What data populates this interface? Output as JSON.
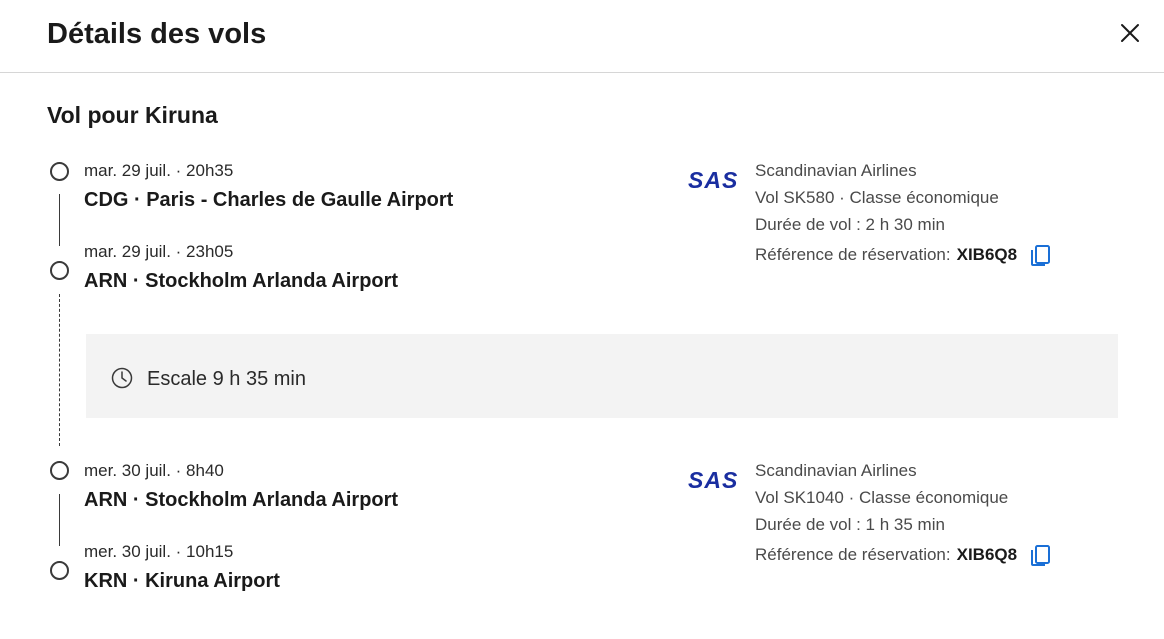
{
  "header": {
    "title": "Détails des vols",
    "close_icon": "close-icon"
  },
  "trip": {
    "section_title": "Vol pour Kiruna",
    "segments": [
      {
        "departure_time": "mar. 29 juil. · 20h35",
        "departure_airport": "CDG · Paris - Charles de Gaulle Airport",
        "arrival_time": "mar. 29 juil. · 23h05",
        "arrival_airport": "ARN · Stockholm Arlanda Airport",
        "airline_logo": "SAS",
        "airline": "Scandinavian Airlines",
        "flight": "Vol SK580 · Classe économique",
        "duration": "Durée de vol : 2 h 30 min",
        "ref_label": "Référence de réservation:",
        "ref_code": "XIB6Q8"
      },
      {
        "departure_time": "mer. 30 juil. · 8h40",
        "departure_airport": "ARN · Stockholm Arlanda Airport",
        "arrival_time": "mer. 30 juil. · 10h15",
        "arrival_airport": "KRN · Kiruna Airport",
        "airline_logo": "SAS",
        "airline": "Scandinavian Airlines",
        "flight": "Vol SK1040 · Classe économique",
        "duration": "Durée de vol : 1 h 35 min",
        "ref_label": "Référence de réservation:",
        "ref_code": "XIB6Q8"
      }
    ],
    "layover": {
      "icon": "clock-icon",
      "text": "Escale 9 h 35 min"
    }
  },
  "colors": {
    "logo_blue": "#1a2ea0",
    "copy_icon_blue": "#1a6fd6",
    "layover_bg": "#f3f3f3"
  }
}
